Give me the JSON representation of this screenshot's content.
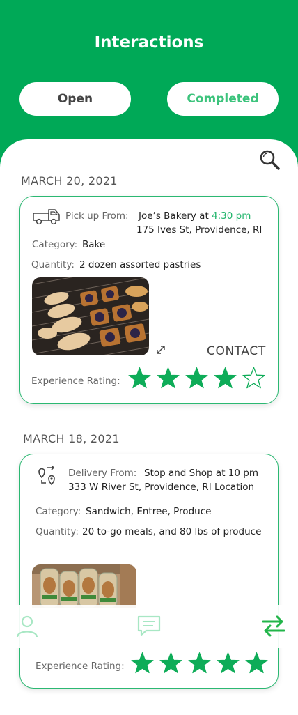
{
  "header": {
    "title": "Interactions"
  },
  "tabs": {
    "open": "Open",
    "completed": "Completed"
  },
  "icons": {
    "search": "search-icon",
    "truck": "truck-icon",
    "delivery": "delivery-route-icon",
    "expand": "expand-icon",
    "star": "star-icon",
    "profile": "profile-icon",
    "messages": "message-icon",
    "swap": "swap-icon"
  },
  "colors": {
    "brand": "#00a957",
    "accent": "#22b56c"
  },
  "interactions": [
    {
      "date": "MARCH 20, 2021",
      "type_label": "Pick up From:",
      "place": "Joe’s Bakery at ",
      "time": "4:30 pm",
      "address": "175 Ives St, Providence, RI",
      "category_label": "Category:",
      "category": "Bake",
      "quantity_label": "Quantity:",
      "quantity": "2 dozen assorted pastries",
      "contact": "CONTACT",
      "rating_label": "Experience Rating:",
      "rating": 4,
      "rating_max": 5
    },
    {
      "date": "MARCH 18, 2021",
      "type_label": "Delivery From:",
      "place": "Stop and Shop at 10 pm",
      "address": "333 W River St, Providence, RI Location",
      "category_label": "Category:",
      "category": "Sandwich, Entree, Produce",
      "quantity_label": "Quantity:",
      "quantity": "20 to-go meals, and 80 lbs of produce",
      "rating_label": "Experience Rating:",
      "rating": 5,
      "rating_max": 5
    }
  ]
}
